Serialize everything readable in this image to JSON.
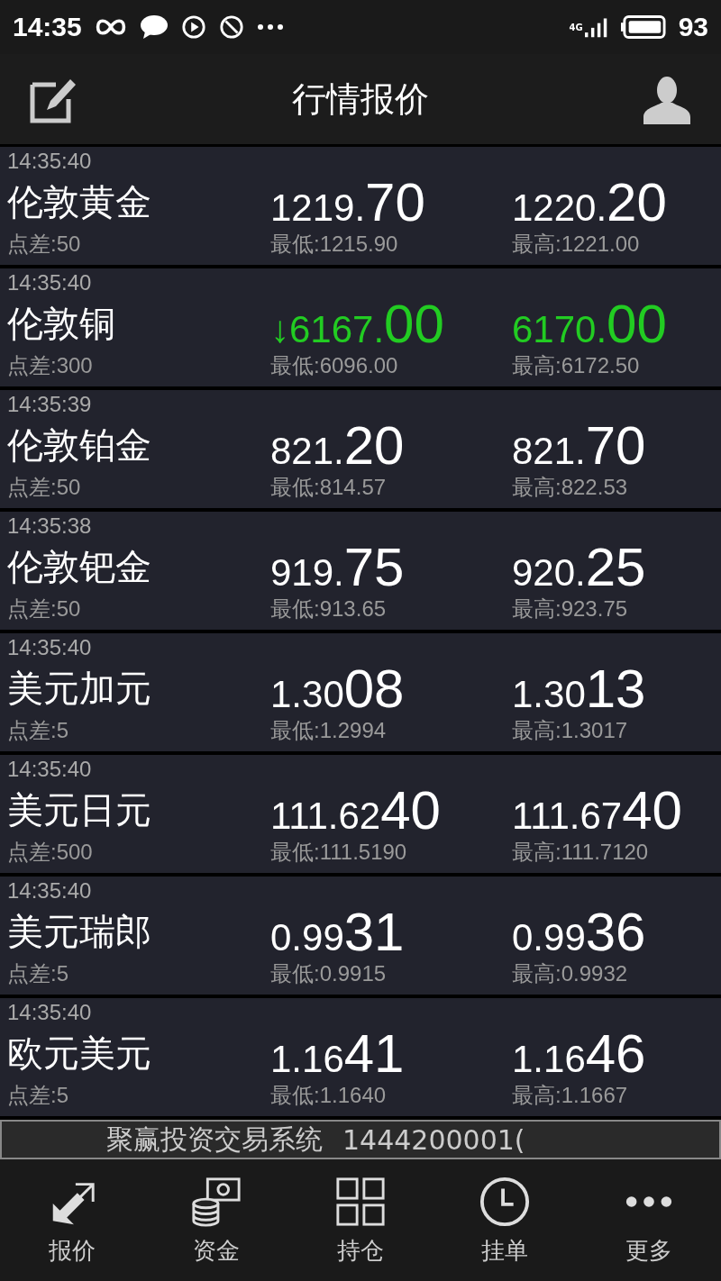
{
  "status_bar": {
    "time": "14:35",
    "network": "4G",
    "battery": "93"
  },
  "header": {
    "title": "行情报价"
  },
  "quotes": [
    {
      "time": "14:35:40",
      "name": "伦敦黄金",
      "spread": "点差:50",
      "bid": {
        "small": "1219.",
        "big": "70",
        "color": "#ffffff"
      },
      "low": "最低:1215.90",
      "ask": {
        "small": "1220.",
        "big": "20",
        "color": "#ffffff"
      },
      "high": "最高:1221.00"
    },
    {
      "time": "14:35:40",
      "name": "伦敦铜",
      "spread": "点差:300",
      "bid": {
        "small": "↓6167.",
        "big": "00",
        "color": "#22cc22"
      },
      "low": "最低:6096.00",
      "ask": {
        "small": "6170.",
        "big": "00",
        "color": "#22cc22"
      },
      "high": "最高:6172.50"
    },
    {
      "time": "14:35:39",
      "name": "伦敦铂金",
      "spread": "点差:50",
      "bid": {
        "small": "821.",
        "big": "20",
        "color": "#ffffff"
      },
      "low": "最低:814.57",
      "ask": {
        "small": "821.",
        "big": "70",
        "color": "#ffffff"
      },
      "high": "最高:822.53"
    },
    {
      "time": "14:35:38",
      "name": "伦敦钯金",
      "spread": "点差:50",
      "bid": {
        "small": "919.",
        "big": "75",
        "color": "#ffffff"
      },
      "low": "最低:913.65",
      "ask": {
        "small": "920.",
        "big": "25",
        "color": "#ffffff"
      },
      "high": "最高:923.75"
    },
    {
      "time": "14:35:40",
      "name": "美元加元",
      "spread": "点差:5",
      "bid": {
        "small": "1.30",
        "big": "08",
        "color": "#ffffff"
      },
      "low": "最低:1.2994",
      "ask": {
        "small": "1.30",
        "big": "13",
        "color": "#ffffff"
      },
      "high": "最高:1.3017"
    },
    {
      "time": "14:35:40",
      "name": "美元日元",
      "spread": "点差:500",
      "bid": {
        "small": "111.62",
        "big": "40",
        "color": "#ffffff"
      },
      "low": "最低:111.5190",
      "ask": {
        "small": "111.67",
        "big": "40",
        "color": "#ffffff"
      },
      "high": "最高:111.7120"
    },
    {
      "time": "14:35:40",
      "name": "美元瑞郎",
      "spread": "点差:5",
      "bid": {
        "small": "0.99",
        "big": "31",
        "color": "#ffffff"
      },
      "low": "最低:0.9915",
      "ask": {
        "small": "0.99",
        "big": "36",
        "color": "#ffffff"
      },
      "high": "最高:0.9932"
    },
    {
      "time": "14:35:40",
      "name": "欧元美元",
      "spread": "点差:5",
      "bid": {
        "small": "1.16",
        "big": "41",
        "color": "#ffffff"
      },
      "low": "最低:1.1640",
      "ask": {
        "small": "1.16",
        "big": "46",
        "color": "#ffffff"
      },
      "high": "最高:1.1667"
    }
  ],
  "ticker": {
    "system": "聚赢投资交易系统",
    "account": "1444200001("
  },
  "nav": [
    {
      "kind": "quotes",
      "label": "报价"
    },
    {
      "kind": "funds",
      "label": "资金"
    },
    {
      "kind": "positions",
      "label": "持仓"
    },
    {
      "kind": "orders",
      "label": "挂单"
    },
    {
      "kind": "more",
      "label": "更多"
    }
  ]
}
